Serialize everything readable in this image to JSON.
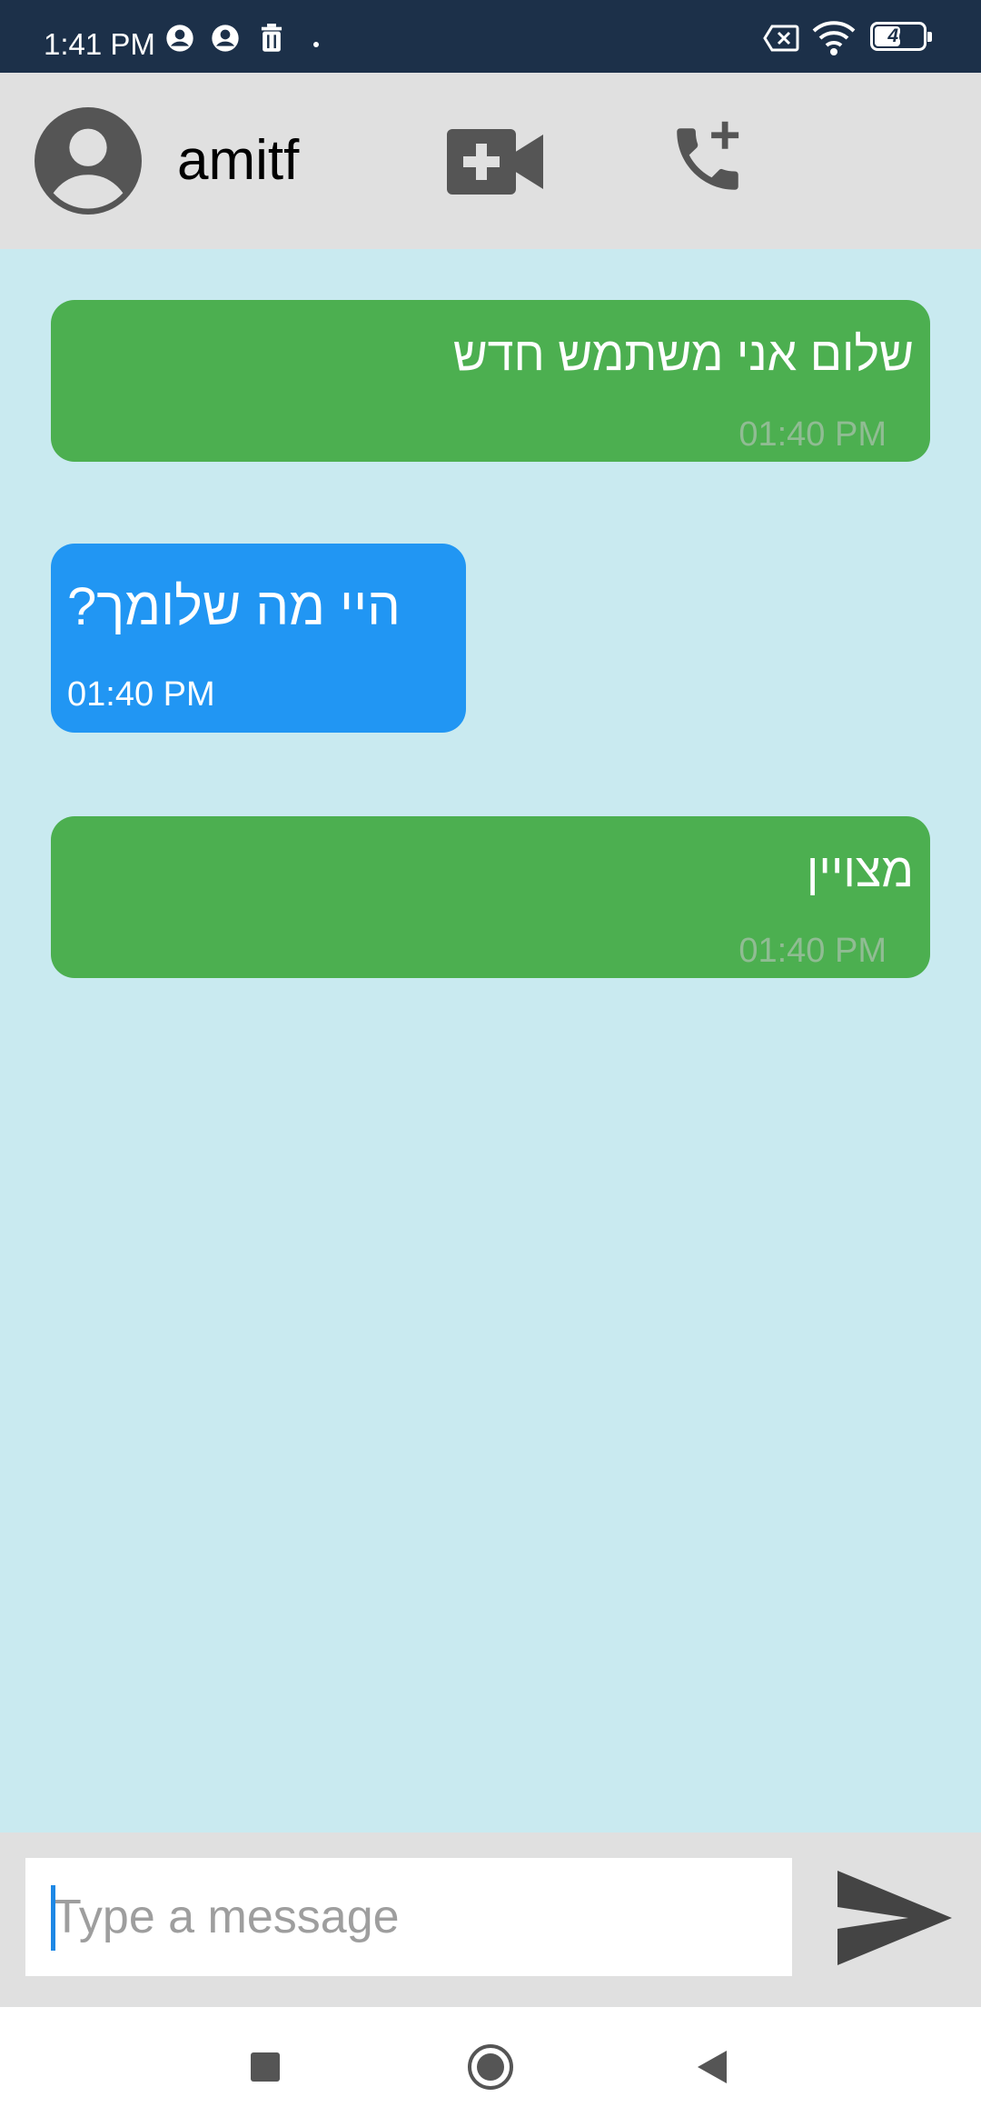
{
  "status_bar": {
    "time": "1:41 PM",
    "battery": "46",
    "icons": [
      "account-circle-icon",
      "account-circle-icon",
      "trash-icon",
      "dot-icon",
      "no-sim-icon",
      "wifi-icon",
      "battery-icon"
    ]
  },
  "header": {
    "contact_name": "amitf",
    "icons": [
      "avatar-icon",
      "video-call-add-icon",
      "add-call-icon"
    ]
  },
  "messages": [
    {
      "direction": "outgoing",
      "text": "שלום אני משתמש חדש",
      "time": "01:40 PM"
    },
    {
      "direction": "incoming",
      "text": "היי מה שלומך?",
      "time": "01:40 PM"
    },
    {
      "direction": "outgoing",
      "text": "מצויין",
      "time": "01:40 PM"
    }
  ],
  "composer": {
    "placeholder": "Type a message",
    "value": "",
    "send_icon": "send-icon"
  },
  "nav_bar": {
    "icons": [
      "recents-square-icon",
      "home-circle-icon",
      "back-triangle-icon"
    ]
  },
  "colors": {
    "status_bar": "#1C3049",
    "app_bar": "#E0E0E0",
    "chat_background": "#C9EAF0",
    "outgoing_bubble": "#4CAF50",
    "incoming_bubble": "#2196F3",
    "icon": "#555555"
  }
}
